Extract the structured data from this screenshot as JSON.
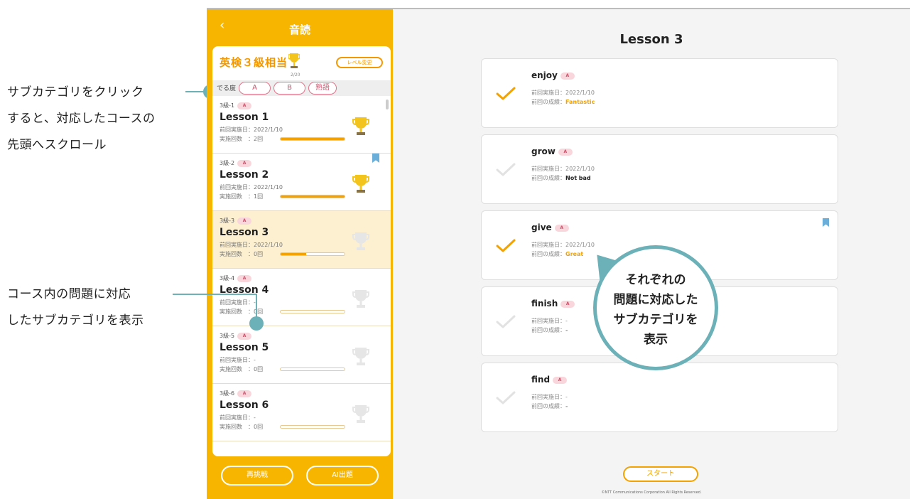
{
  "annotations": {
    "top_lines": [
      "サブカテゴリをクリック",
      "すると、対応したコースの",
      "先頭へスクロール"
    ],
    "bottom_lines": [
      "コース内の問題に対応",
      "したサブカテゴリを表示"
    ],
    "bubble_lines": [
      "それぞれの",
      "問題に対応した",
      "サブカテゴリを",
      "表示"
    ]
  },
  "sidebar": {
    "back_icon": "chevron-left-icon",
    "title": "音読",
    "level_title": "英検３級相当",
    "level_sub": "2/20",
    "level_change": "レベル変更",
    "freq_label": "でる度",
    "freq_chips": [
      "A",
      "B",
      "熟語"
    ],
    "lessons": [
      {
        "code": "3級-1",
        "badge": "A",
        "title": "Lesson 1",
        "date_line": "前回実施日：2022/1/10",
        "count_line": "実施回数　：2回",
        "progress": 1.0,
        "trophy": "gold",
        "bookmark": false,
        "active": false
      },
      {
        "code": "3級-2",
        "badge": "A",
        "title": "Lesson 2",
        "date_line": "前回実施日：2022/1/10",
        "count_line": "実施回数　：1回",
        "progress": 1.0,
        "trophy": "gold",
        "bookmark": true,
        "active": false
      },
      {
        "code": "3級-3",
        "badge": "A",
        "title": "Lesson 3",
        "date_line": "前回実施日：2022/1/10",
        "count_line": "実施回数　：0回",
        "progress": 0.4,
        "trophy": "faded",
        "bookmark": false,
        "active": true
      },
      {
        "code": "3級-4",
        "badge": "A",
        "title": "Lesson 4",
        "date_line": "前回実施日：-",
        "count_line": "実施回数　：0回",
        "progress": 0,
        "trophy": "faded",
        "bookmark": false,
        "active": false
      },
      {
        "code": "3級-5",
        "badge": "A",
        "title": "Lesson 5",
        "date_line": "前回実施日：-",
        "count_line": "実施回数　：0回",
        "progress": 0,
        "trophy": "faded",
        "bookmark": false,
        "active": false
      },
      {
        "code": "3級-6",
        "badge": "A",
        "title": "Lesson 6",
        "date_line": "前回実施日：-",
        "count_line": "実施回数　：0回",
        "progress": 0,
        "trophy": "faded",
        "bookmark": false,
        "active": false
      }
    ],
    "retry_label": "再挑戦",
    "ai_label": "AI出題"
  },
  "main": {
    "title": "Lesson 3",
    "result_prefix": "前回の成績：",
    "questions": [
      {
        "word": "enjoy",
        "badge": "A",
        "date_line": "前回実施日：2022/1/10",
        "result": "Fantastic",
        "result_color": "#f3a200",
        "checked": true,
        "bookmark": false
      },
      {
        "word": "grow",
        "badge": "A",
        "date_line": "前回実施日：2022/1/10",
        "result": "Not bad",
        "result_color": "#222222",
        "checked": false,
        "bookmark": false
      },
      {
        "word": "give",
        "badge": "A",
        "date_line": "前回実施日：2022/1/10",
        "result": "Great",
        "result_color": "#f3a200",
        "checked": true,
        "bookmark": true
      },
      {
        "word": "finish",
        "badge": "A",
        "date_line": "前回実施日：-",
        "result": "-",
        "result_color": "#888888",
        "checked": false,
        "bookmark": false
      },
      {
        "word": "find",
        "badge": "A",
        "date_line": "前回実施日：-",
        "result": "-",
        "result_color": "#888888",
        "checked": false,
        "bookmark": false
      }
    ],
    "start_label": "スタート",
    "copyright": "©NTT Communications Corporation All Rights Reserved."
  },
  "colors": {
    "accent": "#f8b500",
    "annotation": "#6cb0b8",
    "bookmark": "#6aaed9"
  }
}
